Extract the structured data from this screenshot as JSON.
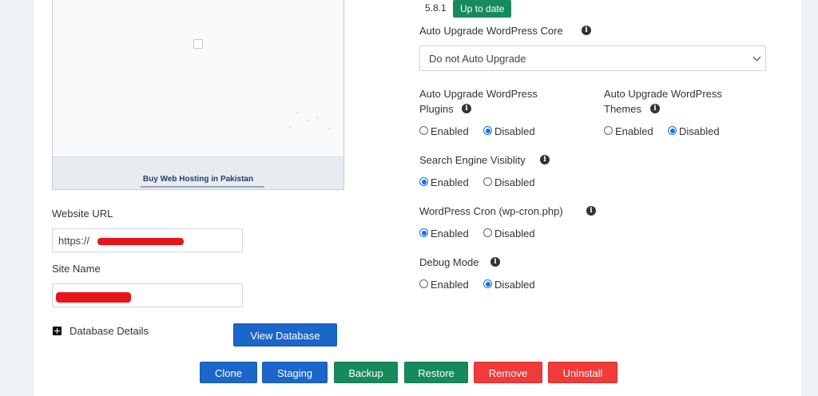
{
  "preview": {
    "site_title": "Buy Web Hosting in Pakistan"
  },
  "website_url": {
    "label": "Website URL",
    "value": "https://"
  },
  "site_name": {
    "label": "Site Name",
    "value": ""
  },
  "database": {
    "toggle_label": "Database Details",
    "view_button": "View Database"
  },
  "version": {
    "number": "5.8.1",
    "status_badge": "Up to date"
  },
  "core_upgrade": {
    "label": "Auto Upgrade WordPress Core",
    "selected": "Do not Auto Upgrade"
  },
  "options": {
    "enabled": "Enabled",
    "disabled": "Disabled"
  },
  "plugins_upgrade": {
    "label_line1": "Auto Upgrade WordPress",
    "label_line2": "Plugins",
    "value": "Disabled"
  },
  "themes_upgrade": {
    "label_line1": "Auto Upgrade WordPress",
    "label_line2": "Themes",
    "value": "Disabled"
  },
  "search_visibility": {
    "label": "Search Engine Visiblity",
    "value": "Enabled"
  },
  "wp_cron": {
    "label": "WordPress Cron (wp-cron.php)",
    "value": "Enabled"
  },
  "debug_mode": {
    "label": "Debug Mode",
    "value": "Disabled"
  },
  "actions": {
    "clone": "Clone",
    "staging": "Staging",
    "backup": "Backup",
    "restore": "Restore",
    "remove": "Remove",
    "uninstall": "Uninstall"
  },
  "colors": {
    "primary_blue": "#1b66c9",
    "success_green": "#178a5c",
    "danger_red": "#ef3b39",
    "radio_blue": "#1a6fe0",
    "redaction_red": "#e8141c"
  }
}
